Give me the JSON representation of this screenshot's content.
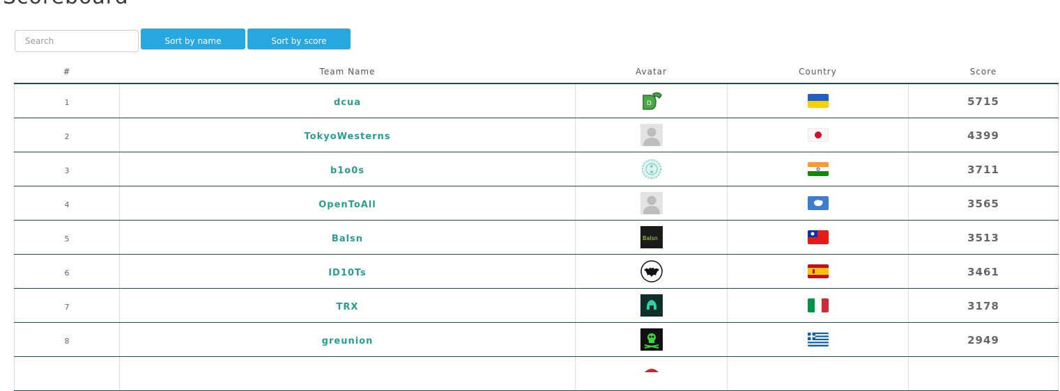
{
  "page": {
    "title": "Scoreboard"
  },
  "search": {
    "placeholder": "Search",
    "value": ""
  },
  "buttons": {
    "sort_name": "Sort by name",
    "sort_score": "Sort by score"
  },
  "table": {
    "headers": {
      "rank": "#",
      "team": "Team Name",
      "avatar": "Avatar",
      "country": "Country",
      "score": "Score"
    },
    "rows": [
      {
        "rank": "1",
        "team": "dcua",
        "avatar": "dc-logo-avatar",
        "country": "ukraine-flag-icon",
        "score": "5715"
      },
      {
        "rank": "2",
        "team": "TokyoWesterns",
        "avatar": "default-user-avatar",
        "country": "japan-flag-icon",
        "score": "4399"
      },
      {
        "rank": "3",
        "team": "b1o0s",
        "avatar": "ornament-avatar",
        "country": "india-flag-icon",
        "score": "3711"
      },
      {
        "rank": "4",
        "team": "OpenToAll",
        "avatar": "default-user-avatar",
        "country": "antarctica-flag-icon",
        "score": "3565"
      },
      {
        "rank": "5",
        "team": "Balsn",
        "avatar": "balsn-logo-avatar",
        "country": "taiwan-flag-icon",
        "score": "3513"
      },
      {
        "rank": "6",
        "team": "ID10Ts",
        "avatar": "bat-logo-avatar",
        "country": "spain-flag-icon",
        "score": "3461"
      },
      {
        "rank": "7",
        "team": "TRX",
        "avatar": "helmet-logo-avatar",
        "country": "italy-flag-icon",
        "score": "3178"
      },
      {
        "rank": "8",
        "team": "greunion",
        "avatar": "skull-logo-avatar",
        "country": "greece-flag-icon",
        "score": "2949"
      },
      {
        "rank": "",
        "team": "",
        "avatar": "partial-avatar",
        "country": "",
        "score": ""
      }
    ]
  },
  "colors": {
    "accent": "#28a7e0",
    "link": "#2a9c8f",
    "row_border": "#1f4a4a"
  }
}
